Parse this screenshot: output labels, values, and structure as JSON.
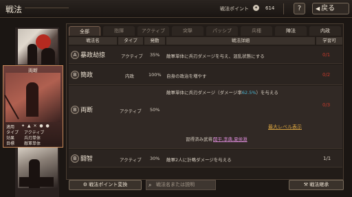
{
  "header": {
    "title": "戦法",
    "points_label": "戦法ポイント",
    "points_value": "614",
    "help_label": "?",
    "back_label": "戻る"
  },
  "selected_card": {
    "name": "両断",
    "icons": "✦ ▲ ✕ ● ●",
    "stats": [
      {
        "key": "適用",
        "value": ""
      },
      {
        "key": "タイプ",
        "value": "アクティブ"
      },
      {
        "key": "効果",
        "value": "兵刃単体"
      },
      {
        "key": "目標",
        "value": "敵軍単体"
      }
    ]
  },
  "tabs": [
    {
      "label": "全部",
      "active": true
    },
    {
      "label": "指揮",
      "active": false
    },
    {
      "label": "アクティブ",
      "active": false
    },
    {
      "label": "突撃",
      "active": false
    },
    {
      "label": "パッシブ",
      "active": false
    },
    {
      "label": "兵種",
      "active": false
    },
    {
      "label": "陣法",
      "active": false
    },
    {
      "label": "内政",
      "active": false
    }
  ],
  "columns": {
    "name": "戦法名",
    "type": "タイプ",
    "rate": "発動",
    "detail": "戦法詳細",
    "learn": "学習可"
  },
  "rows": [
    {
      "rank": "A",
      "name": "暴政劫掠",
      "type": "アクティブ",
      "rate": "35%",
      "detail": "敵軍単体に兵刃ダメージを与え、混乱状態にする",
      "learn": "0/1"
    },
    {
      "rank": "B",
      "name": "簡政",
      "type": "内政",
      "rate": "100%",
      "detail": "自身の政治を増やす",
      "learn": "0/2"
    },
    {
      "rank": "B",
      "name": "両断",
      "type": "アクティブ",
      "rate": "50%",
      "detail_prefix": "敵軍単体に兵刃ダメージ（ダメージ率",
      "detail_rate": "62.5%",
      "detail_suffix": "）を与える",
      "learn": "0/3",
      "max_level_label": "最大レベル表示",
      "learned_label": "習得済み武将:",
      "learned_names": "関平,李典,夏侯淵"
    },
    {
      "rank": "B",
      "name": "闘智",
      "type": "アクティブ",
      "rate": "30%",
      "detail": "敵軍2人に計略ダメージを与える",
      "learn": "1/1"
    }
  ],
  "footer": {
    "convert_label": "戦法ポイント変換",
    "search_placeholder": "戦法名または説明",
    "inherit_label": "戦法継承"
  }
}
